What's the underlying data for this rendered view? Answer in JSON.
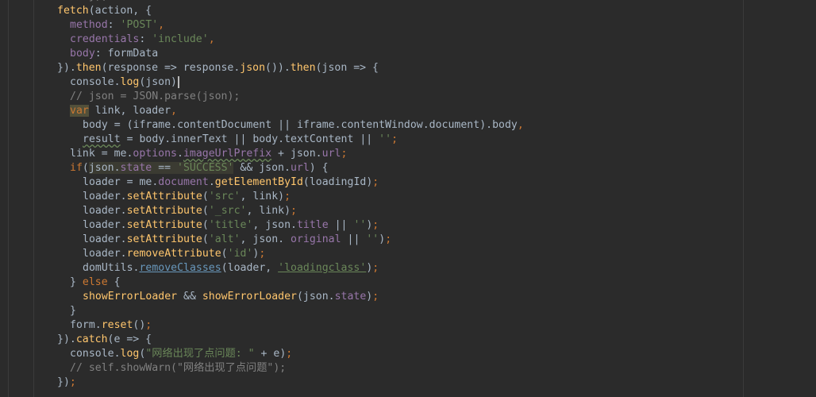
{
  "editor": {
    "lines": [
      {
        "indent": 5,
        "tokens": [
          {
            "t": "// });",
            "c": "cmt"
          }
        ]
      },
      {
        "indent": 4,
        "tokens": [
          {
            "t": "fetch",
            "c": "fn"
          },
          {
            "t": "(action, {",
            "c": "plain"
          }
        ]
      },
      {
        "indent": 5,
        "tokens": [
          {
            "t": "method",
            "c": "prop"
          },
          {
            "t": ": ",
            "c": "plain"
          },
          {
            "t": "'POST'",
            "c": "str"
          },
          {
            "t": ",",
            "c": "kw"
          }
        ]
      },
      {
        "indent": 5,
        "tokens": [
          {
            "t": "credentials",
            "c": "prop"
          },
          {
            "t": ": ",
            "c": "plain"
          },
          {
            "t": "'include'",
            "c": "str"
          },
          {
            "t": ",",
            "c": "kw"
          }
        ]
      },
      {
        "indent": 5,
        "tokens": [
          {
            "t": "body",
            "c": "prop"
          },
          {
            "t": ": formData",
            "c": "plain"
          }
        ]
      },
      {
        "indent": 4,
        "tokens": [
          {
            "t": "}).",
            "c": "plain"
          },
          {
            "t": "then",
            "c": "fn"
          },
          {
            "t": "(response => response.",
            "c": "plain"
          },
          {
            "t": "json",
            "c": "fn"
          },
          {
            "t": "()).",
            "c": "plain"
          },
          {
            "t": "then",
            "c": "fn"
          },
          {
            "t": "(json => {",
            "c": "plain"
          }
        ]
      },
      {
        "indent": 5,
        "caret": true,
        "tokens": [
          {
            "t": "console.",
            "c": "plain"
          },
          {
            "t": "log",
            "c": "fn"
          },
          {
            "t": "(json)",
            "c": "plain"
          }
        ]
      },
      {
        "indent": 5,
        "tokens": [
          {
            "t": "// json = JSON.parse(json);",
            "c": "cmt"
          }
        ]
      },
      {
        "indent": 5,
        "tokens": [
          {
            "t": "var",
            "c": "kw",
            "hl": "kw"
          },
          {
            "t": " link, loader",
            "c": "plain"
          },
          {
            "t": ",",
            "c": "kw"
          }
        ]
      },
      {
        "indent": 6,
        "tokens": [
          {
            "t": "body = (iframe.contentDocument || iframe.contentWindow.document).body",
            "c": "plain"
          },
          {
            "t": ",",
            "c": "kw"
          }
        ]
      },
      {
        "indent": 6,
        "tokens": [
          {
            "t": "result",
            "c": "plain",
            "wavy": true
          },
          {
            "t": " = body.innerText || body.textContent || ",
            "c": "plain"
          },
          {
            "t": "''",
            "c": "str"
          },
          {
            "t": ";",
            "c": "kw"
          }
        ]
      },
      {
        "indent": 5,
        "tokens": [
          {
            "t": "link = me.",
            "c": "plain"
          },
          {
            "t": "options",
            "c": "prop"
          },
          {
            "t": ".",
            "c": "plain"
          },
          {
            "t": "imageUrlPrefix",
            "c": "prop",
            "wavy": true
          },
          {
            "t": " + json.",
            "c": "plain"
          },
          {
            "t": "url",
            "c": "prop"
          },
          {
            "t": ";",
            "c": "kw"
          }
        ]
      },
      {
        "indent": 5,
        "tokens": [
          {
            "t": "if",
            "c": "kw"
          },
          {
            "t": "(",
            "c": "plain"
          },
          {
            "t": "json.",
            "c": "plain",
            "hl": "on"
          },
          {
            "t": "state",
            "c": "prop",
            "hl": "on"
          },
          {
            "t": " == ",
            "c": "plain",
            "hl": "on"
          },
          {
            "t": "'SUCCESS'",
            "c": "str",
            "hl": "on"
          },
          {
            "t": " && json.",
            "c": "plain"
          },
          {
            "t": "url",
            "c": "prop"
          },
          {
            "t": ") {",
            "c": "plain"
          }
        ]
      },
      {
        "indent": 6,
        "tokens": [
          {
            "t": "loader = me.",
            "c": "plain"
          },
          {
            "t": "document",
            "c": "prop"
          },
          {
            "t": ".",
            "c": "plain"
          },
          {
            "t": "getElementById",
            "c": "fn"
          },
          {
            "t": "(loadingId)",
            "c": "plain"
          },
          {
            "t": ";",
            "c": "kw"
          }
        ]
      },
      {
        "indent": 6,
        "tokens": [
          {
            "t": "loader.",
            "c": "plain"
          },
          {
            "t": "setAttribute",
            "c": "fn"
          },
          {
            "t": "(",
            "c": "plain"
          },
          {
            "t": "'src'",
            "c": "str"
          },
          {
            "t": ", link)",
            "c": "plain"
          },
          {
            "t": ";",
            "c": "kw"
          }
        ]
      },
      {
        "indent": 6,
        "tokens": [
          {
            "t": "loader.",
            "c": "plain"
          },
          {
            "t": "setAttribute",
            "c": "fn"
          },
          {
            "t": "(",
            "c": "plain"
          },
          {
            "t": "'_src'",
            "c": "str"
          },
          {
            "t": ", link)",
            "c": "plain"
          },
          {
            "t": ";",
            "c": "kw"
          }
        ]
      },
      {
        "indent": 6,
        "tokens": [
          {
            "t": "loader.",
            "c": "plain"
          },
          {
            "t": "setAttribute",
            "c": "fn"
          },
          {
            "t": "(",
            "c": "plain"
          },
          {
            "t": "'title'",
            "c": "str"
          },
          {
            "t": ", json.",
            "c": "plain"
          },
          {
            "t": "title",
            "c": "prop"
          },
          {
            "t": " || ",
            "c": "plain"
          },
          {
            "t": "''",
            "c": "str"
          },
          {
            "t": ")",
            "c": "plain"
          },
          {
            "t": ";",
            "c": "kw"
          }
        ]
      },
      {
        "indent": 6,
        "tokens": [
          {
            "t": "loader.",
            "c": "plain"
          },
          {
            "t": "setAttribute",
            "c": "fn"
          },
          {
            "t": "(",
            "c": "plain"
          },
          {
            "t": "'alt'",
            "c": "str"
          },
          {
            "t": ", json. ",
            "c": "plain"
          },
          {
            "t": "original",
            "c": "prop"
          },
          {
            "t": " || ",
            "c": "plain"
          },
          {
            "t": "''",
            "c": "str"
          },
          {
            "t": ")",
            "c": "plain"
          },
          {
            "t": ";",
            "c": "kw"
          }
        ]
      },
      {
        "indent": 6,
        "tokens": [
          {
            "t": "loader.",
            "c": "plain"
          },
          {
            "t": "removeAttribute",
            "c": "fn"
          },
          {
            "t": "(",
            "c": "plain"
          },
          {
            "t": "'id'",
            "c": "str"
          },
          {
            "t": ")",
            "c": "plain"
          },
          {
            "t": ";",
            "c": "kw"
          }
        ]
      },
      {
        "indent": 6,
        "tokens": [
          {
            "t": "domUtils.",
            "c": "plain"
          },
          {
            "t": "removeClasses",
            "c": "ulink"
          },
          {
            "t": "(loader, ",
            "c": "plain"
          },
          {
            "t": "'loadingclass'",
            "c": "ustr"
          },
          {
            "t": ")",
            "c": "plain"
          },
          {
            "t": ";",
            "c": "kw"
          }
        ]
      },
      {
        "indent": 5,
        "tokens": [
          {
            "t": "} ",
            "c": "plain"
          },
          {
            "t": "else",
            "c": "kw"
          },
          {
            "t": " {",
            "c": "plain"
          }
        ]
      },
      {
        "indent": 6,
        "tokens": [
          {
            "t": "showErrorLoader",
            "c": "fn"
          },
          {
            "t": " && ",
            "c": "plain"
          },
          {
            "t": "showErrorLoader",
            "c": "fn"
          },
          {
            "t": "(json.",
            "c": "plain"
          },
          {
            "t": "state",
            "c": "prop"
          },
          {
            "t": ")",
            "c": "plain"
          },
          {
            "t": ";",
            "c": "kw"
          }
        ]
      },
      {
        "indent": 5,
        "tokens": [
          {
            "t": "}",
            "c": "plain"
          }
        ]
      },
      {
        "indent": 5,
        "tokens": [
          {
            "t": "form.",
            "c": "plain"
          },
          {
            "t": "reset",
            "c": "fn"
          },
          {
            "t": "()",
            "c": "plain"
          },
          {
            "t": ";",
            "c": "kw"
          }
        ]
      },
      {
        "indent": 4,
        "tokens": [
          {
            "t": "}).",
            "c": "plain"
          },
          {
            "t": "catch",
            "c": "fn"
          },
          {
            "t": "(e => {",
            "c": "plain"
          }
        ]
      },
      {
        "indent": 5,
        "tokens": [
          {
            "t": "console.",
            "c": "plain"
          },
          {
            "t": "log",
            "c": "fn"
          },
          {
            "t": "(",
            "c": "plain"
          },
          {
            "t": "\"网络出现了点问题: \"",
            "c": "str"
          },
          {
            "t": " + e)",
            "c": "plain"
          },
          {
            "t": ";",
            "c": "kw"
          }
        ]
      },
      {
        "indent": 5,
        "tokens": [
          {
            "t": "// self.showWarn(\"网络出现了点问题\");",
            "c": "cmt"
          }
        ]
      },
      {
        "indent": 4,
        "tokens": [
          {
            "t": "})",
            "c": "plain"
          },
          {
            "t": ";",
            "c": "kw"
          }
        ]
      }
    ]
  }
}
